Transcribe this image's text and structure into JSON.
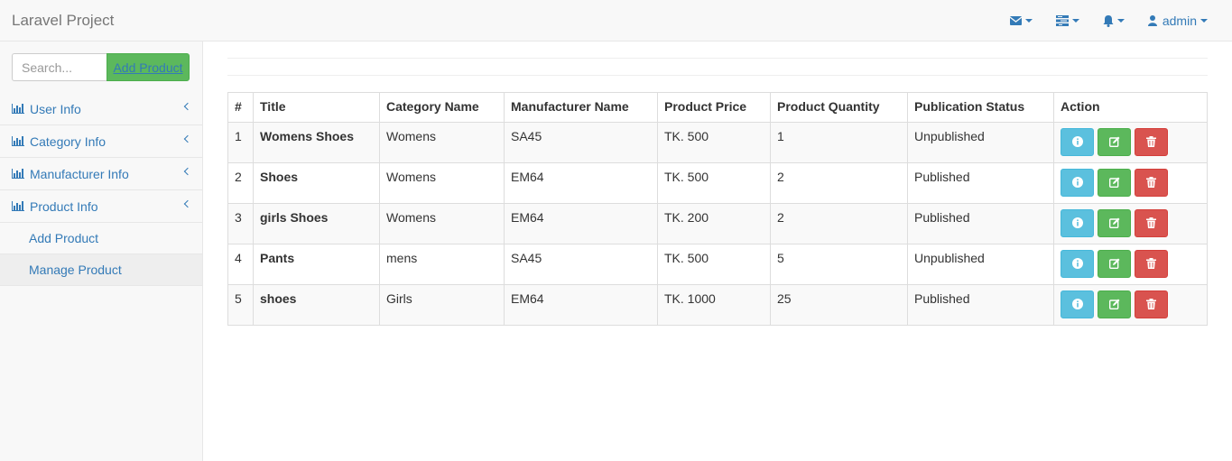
{
  "navbar": {
    "brand": "Laravel Project",
    "user_label": "admin",
    "icons": [
      "envelope-icon",
      "tasks-icon",
      "bell-icon",
      "user-icon"
    ]
  },
  "sidebar": {
    "search": {
      "placeholder": "Search...",
      "value": ""
    },
    "add_button_label": "Add Product",
    "items": [
      {
        "label": "User Info"
      },
      {
        "label": "Category Info"
      },
      {
        "label": "Manufacturer Info"
      },
      {
        "label": "Product Info"
      }
    ],
    "sub_items": [
      {
        "label": "Add Product"
      },
      {
        "label": "Manage Product"
      }
    ]
  },
  "table": {
    "headers": [
      "#",
      "Title",
      "Category Name",
      "Manufacturer Name",
      "Product Price",
      "Product Quantity",
      "Publication Status",
      "Action"
    ],
    "rows": [
      {
        "id": "1",
        "title": "Womens Shoes",
        "category": "Womens",
        "manufacturer": "SA45",
        "price": "TK. 500",
        "quantity": "1",
        "status": "Unpublished"
      },
      {
        "id": "2",
        "title": "Shoes",
        "category": "Womens",
        "manufacturer": "EM64",
        "price": "TK. 500",
        "quantity": "2",
        "status": "Published"
      },
      {
        "id": "3",
        "title": "girls Shoes",
        "category": "Womens",
        "manufacturer": "EM64",
        "price": "TK. 200",
        "quantity": "2",
        "status": "Published"
      },
      {
        "id": "4",
        "title": "Pants",
        "category": "mens",
        "manufacturer": "SA45",
        "price": "TK. 500",
        "quantity": "5",
        "status": "Unpublished"
      },
      {
        "id": "5",
        "title": "shoes",
        "category": "Girls",
        "manufacturer": "EM64",
        "price": "TK. 1000",
        "quantity": "25",
        "status": "Published"
      }
    ]
  },
  "colors": {
    "link": "#337ab7",
    "success": "#5cb85c",
    "info": "#5bc0de",
    "danger": "#d9534f"
  }
}
